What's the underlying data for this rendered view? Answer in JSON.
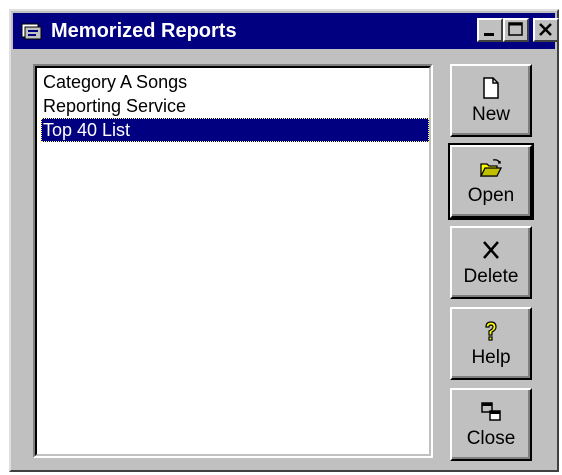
{
  "window": {
    "title": "Memorized Reports"
  },
  "list": {
    "items": [
      {
        "label": "Category A Songs",
        "selected": false
      },
      {
        "label": "Reporting Service",
        "selected": false
      },
      {
        "label": "Top 40 List",
        "selected": true
      }
    ]
  },
  "buttons": {
    "new_label": "New",
    "open_label": "Open",
    "delete_label": "Delete",
    "help_label": "Help",
    "close_label": "Close"
  },
  "icons": {
    "app": "report-icon",
    "new": "new-document-icon",
    "open": "open-folder-icon",
    "delete": "x-delete-icon",
    "help": "question-mark-icon",
    "close": "close-windows-icon"
  },
  "colors": {
    "titlebar": "#000080",
    "face": "#c0c0c0",
    "selection": "#000080"
  }
}
